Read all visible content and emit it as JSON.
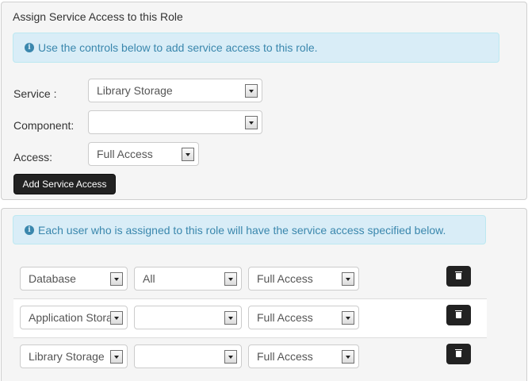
{
  "assign_panel": {
    "title": "Assign Service Access to this Role",
    "info_text": "Use the controls below to add service access to this role.",
    "service_label": "Service :",
    "service_value": "Library Storage",
    "component_label": "Component:",
    "component_value": "",
    "access_label": "Access:",
    "access_value": "Full Access",
    "add_button_label": "Add Service Access"
  },
  "list_panel": {
    "info_text": "Each user who is assigned to this role will have the service access specified below.",
    "rows": [
      {
        "service": "Database",
        "component": "All",
        "access": "Full Access"
      },
      {
        "service": "Application Storage",
        "component": "",
        "access": "Full Access"
      },
      {
        "service": "Library Storage",
        "component": "",
        "access": "Full Access"
      }
    ]
  },
  "icons": {
    "info": "info-icon",
    "dropdown": "chevron-down-icon",
    "delete": "trash-icon"
  },
  "colors": {
    "alert_bg": "#d9edf7",
    "alert_text": "#3a87ad",
    "dark_button": "#222222",
    "panel_bg": "#f5f5f5"
  }
}
